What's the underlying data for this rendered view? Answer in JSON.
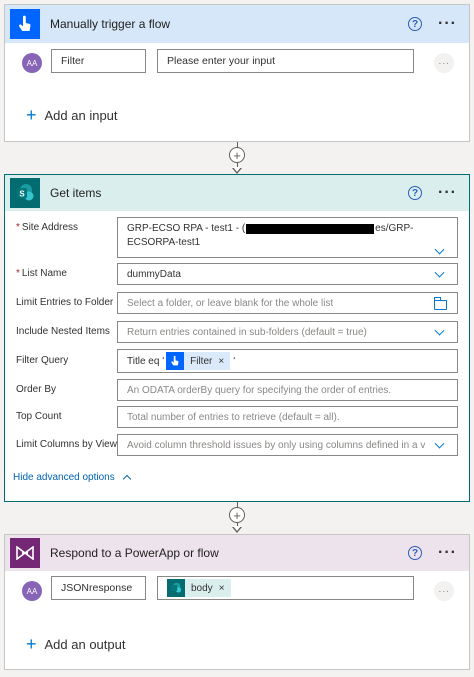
{
  "trigger": {
    "title": "Manually trigger a flow",
    "help": "?",
    "more": "···",
    "avatar_text": "AA",
    "input_name": "Filter",
    "input_placeholder": "Please enter your input",
    "row_more": "···",
    "add_label": "Add an input",
    "header_color": "#d5e7f8",
    "icon_color": "#0066ff"
  },
  "connectors": [
    {
      "symbol": "+"
    },
    {
      "symbol": "+"
    }
  ],
  "get_items": {
    "title": "Get items",
    "help": "?",
    "more": "···",
    "header_color": "#dbeeee",
    "accent_color": "#036c70",
    "fields": {
      "site_address": {
        "label": "Site Address",
        "required": "*",
        "value_line1_prefix": "GRP-ECSO RPA - test1 - (",
        "value_line1_suffix": "es/GRP-",
        "value_line2": "ECSORPA-test1"
      },
      "list_name": {
        "label": "List Name",
        "required": "*",
        "value": "dummyData"
      },
      "limit_folder": {
        "label": "Limit Entries to Folder",
        "placeholder": "Select a folder, or leave blank for the whole list"
      },
      "nested_items": {
        "label": "Include Nested Items",
        "placeholder": "Return entries contained in sub-folders (default = true)"
      },
      "filter_query": {
        "label": "Filter Query",
        "prefix": "Title eq '",
        "token": "Filter",
        "token_close": "×",
        "suffix": "'"
      },
      "order_by": {
        "label": "Order By",
        "placeholder": "An ODATA orderBy query for specifying the order of entries."
      },
      "top_count": {
        "label": "Top Count",
        "placeholder": "Total number of entries to retrieve (default = all)."
      },
      "limit_columns": {
        "label": "Limit Columns by View",
        "placeholder": "Avoid column threshold issues by only using columns defined in a view"
      }
    },
    "advanced_link": "Hide advanced options"
  },
  "respond": {
    "title": "Respond to a PowerApp or flow",
    "help": "?",
    "more": "···",
    "header_color": "#ece3ec",
    "icon_color": "#742774",
    "avatar_text": "AA",
    "output_name": "JSONresponse",
    "token": "body",
    "token_close": "×",
    "row_more": "···",
    "add_label": "Add an output"
  }
}
